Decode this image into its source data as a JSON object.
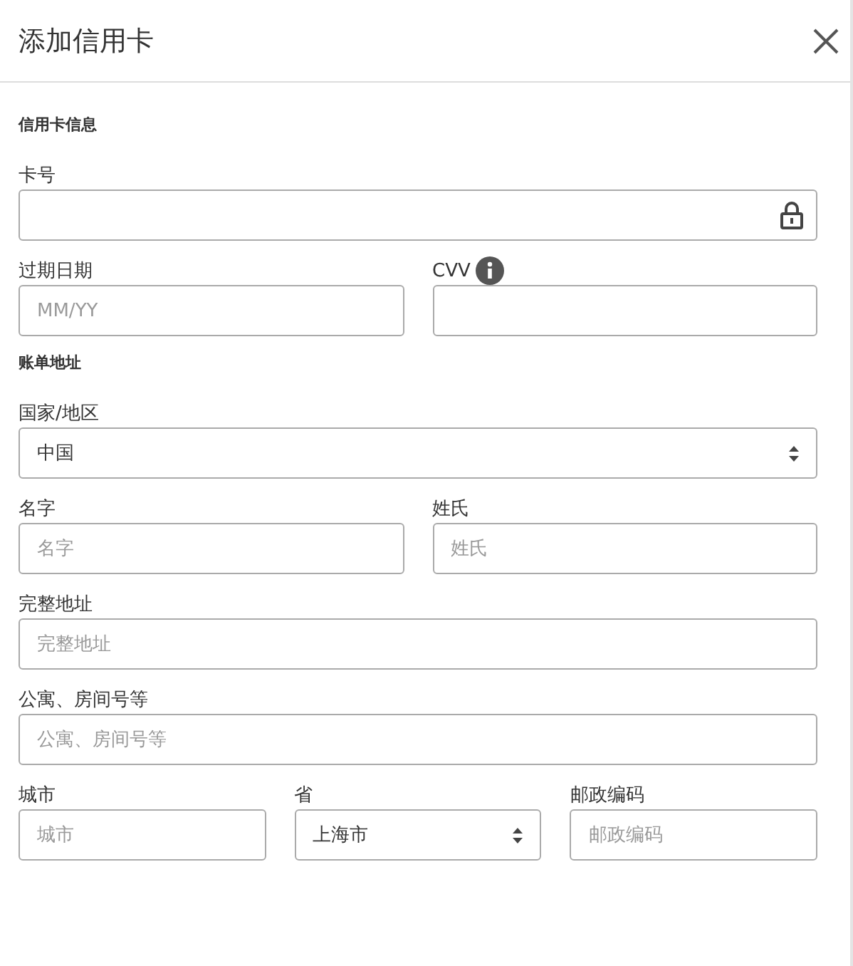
{
  "dialog": {
    "title": "添加信用卡"
  },
  "sections": [
    {
      "heading": "信用卡信息",
      "rows": [
        [
          {
            "label": "卡号",
            "kind": "secure"
          }
        ],
        [
          {
            "label": "过期日期",
            "kind": "text",
            "placeholder": "MM/YY"
          },
          {
            "label": "CVV",
            "kind": "text",
            "info": true
          }
        ]
      ]
    },
    {
      "heading": "账单地址",
      "rows": [
        [
          {
            "label": "国家/地区",
            "kind": "select",
            "value": "中国"
          }
        ],
        [
          {
            "label": "名字",
            "kind": "text",
            "placeholder": "名字"
          },
          {
            "label": "姓氏",
            "kind": "text",
            "placeholder": "姓氏"
          }
        ],
        [
          {
            "label": "完整地址",
            "kind": "text",
            "placeholder": "完整地址"
          }
        ],
        [
          {
            "label": "公寓、房间号等",
            "kind": "text",
            "placeholder": "公寓、房间号等"
          }
        ],
        [
          {
            "label": "城市",
            "kind": "text",
            "placeholder": "城市"
          },
          {
            "label": "省",
            "kind": "select",
            "value": "上海市"
          },
          {
            "label": "邮政编码",
            "kind": "text",
            "placeholder": "邮政编码"
          }
        ]
      ]
    }
  ]
}
